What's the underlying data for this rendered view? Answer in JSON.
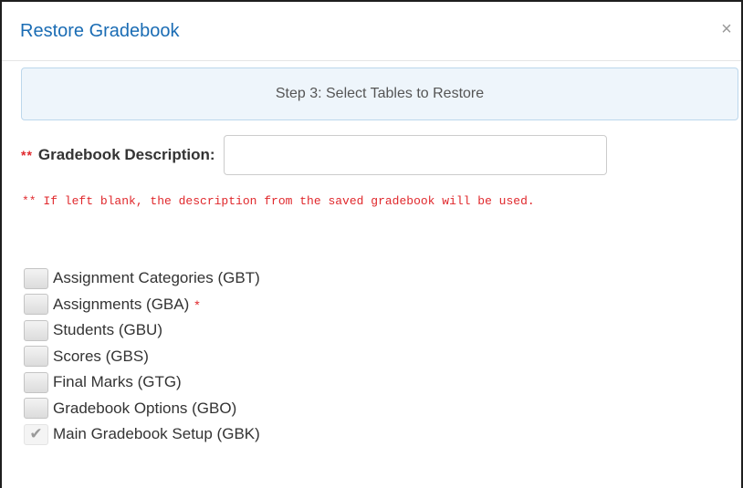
{
  "dialog": {
    "title": "Restore Gradebook",
    "close_glyph": "×",
    "step_text": "Step 3: Select Tables to Restore",
    "description": {
      "required_marker": "**",
      "label": "Gradebook Description:",
      "value": "",
      "placeholder": ""
    },
    "note": "** If left blank, the description from the saved gradebook will be used.",
    "tables": [
      {
        "label": "Assignment Categories (GBT)",
        "checked": false,
        "required_marker": ""
      },
      {
        "label": "Assignments (GBA)",
        "checked": false,
        "required_marker": "*"
      },
      {
        "label": "Students (GBU)",
        "checked": false,
        "required_marker": ""
      },
      {
        "label": "Scores (GBS)",
        "checked": false,
        "required_marker": ""
      },
      {
        "label": "Final Marks (GTG)",
        "checked": false,
        "required_marker": ""
      },
      {
        "label": "Gradebook Options (GBO)",
        "checked": false,
        "required_marker": ""
      },
      {
        "label": "Main Gradebook Setup (GBK)",
        "checked": true,
        "required_marker": ""
      }
    ],
    "check_glyph": "✔",
    "colors": {
      "title": "#1a6cb4",
      "required": "#e0282c",
      "step_bg": "#eef5fb",
      "step_border": "#bcd7ec"
    }
  }
}
